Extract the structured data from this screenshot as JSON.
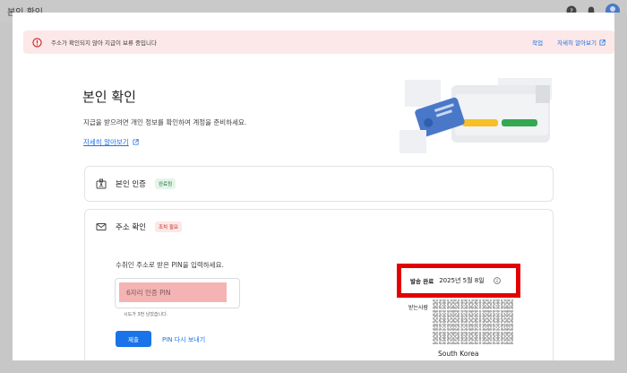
{
  "app": {
    "title": "본인 확인"
  },
  "banner": {
    "message": "주소가 확인되지 않아 지급이 보류 중입니다",
    "action_fix": "작업",
    "action_learn": "자세히 알아보기"
  },
  "header": {
    "title": "본인 확인",
    "description": "지급을 받으려면 개인 정보를 확인하여 계정을 준비하세요.",
    "learn_more": "자세히 알아보기"
  },
  "identity_card": {
    "title": "본인 인증",
    "badge": "완료됨"
  },
  "address_card": {
    "title": "주소 확인",
    "badge": "조치 필요",
    "instruction": "수취인 주소로 받은 PIN을 입력하세요.",
    "pin_placeholder": "6자리 인증 PIN",
    "attempts_hint": "시도가 3번 남았습니다.",
    "submit_label": "제출",
    "resend_label": "PIN 다시 보내기",
    "sent_label": "발송 완료",
    "sent_date": "2025년 5월 8일",
    "recipient_label": "받는사람",
    "country": "South Korea"
  },
  "colors": {
    "accent": "#1a73e8",
    "alert_bg": "#fce8e8",
    "highlight": "#e30000",
    "success": "#137333",
    "error": "#c5221f"
  },
  "icons": [
    "help-icon",
    "bell-icon",
    "avatar",
    "warning-icon",
    "external-link-icon",
    "id-badge-icon",
    "mail-icon",
    "info-icon"
  ]
}
